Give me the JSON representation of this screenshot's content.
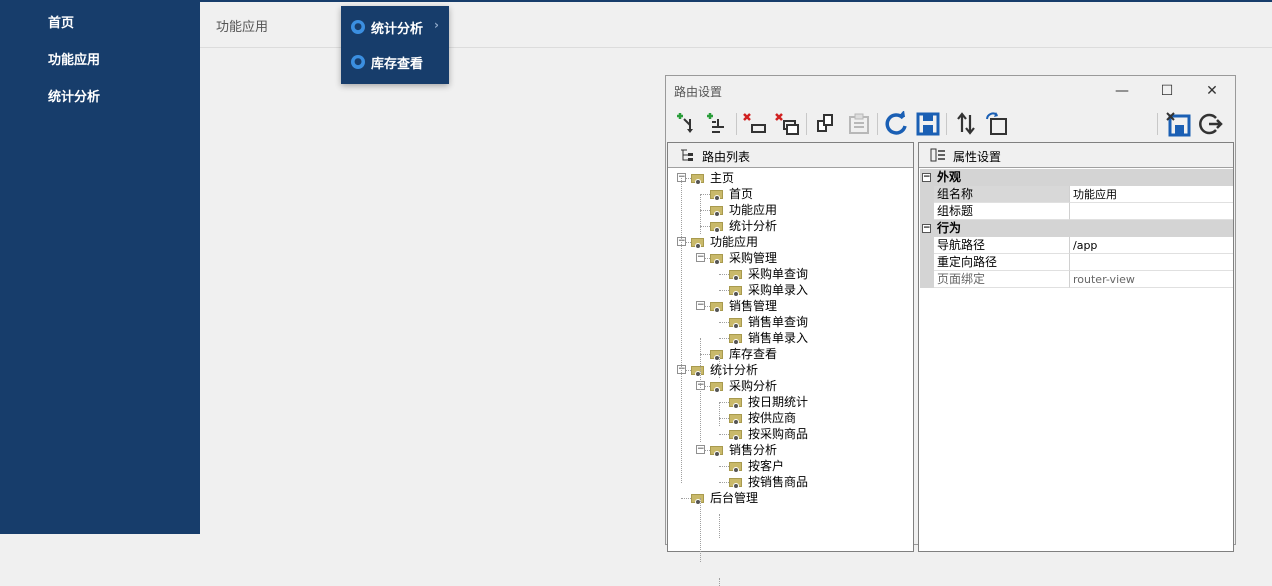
{
  "sidebar": {
    "items": [
      {
        "label": "首页"
      },
      {
        "label": "功能应用"
      },
      {
        "label": "统计分析"
      }
    ]
  },
  "breadcrumb": "功能应用",
  "popup": {
    "items": [
      {
        "label": "统计分析",
        "arrow": "›"
      },
      {
        "label": "库存查看"
      }
    ]
  },
  "window": {
    "title": "路由设置",
    "controls": {
      "minimize": "—",
      "maximize": "☐",
      "close": "✕"
    },
    "left_pane": {
      "title": "路由列表"
    },
    "right_pane": {
      "title": "属性设置"
    },
    "tree": [
      "主页",
      "首页",
      "功能应用",
      "统计分析",
      "功能应用",
      "采购管理",
      "采购单查询",
      "采购单录入",
      "销售管理",
      "销售单查询",
      "销售单录入",
      "库存查看",
      "统计分析",
      "采购分析",
      "按日期统计",
      "按供应商",
      "按采购商品",
      "销售分析",
      "按客户",
      "按销售商品",
      "后台管理"
    ],
    "properties": {
      "cat1": "外观",
      "rows1": [
        {
          "key": "组名称",
          "value": "功能应用"
        },
        {
          "key": "组标题",
          "value": ""
        }
      ],
      "cat2": "行为",
      "rows2": [
        {
          "key": "导航路径",
          "value": "/app"
        },
        {
          "key": "重定向路径",
          "value": ""
        },
        {
          "key": "页面绑定",
          "value": "router-view"
        }
      ]
    }
  },
  "colors": {
    "sidebar": "#173d6b",
    "toolbar_green": "#2a9d3a",
    "toolbar_red": "#d02020",
    "toolbar_blue": "#1a5fb4"
  }
}
